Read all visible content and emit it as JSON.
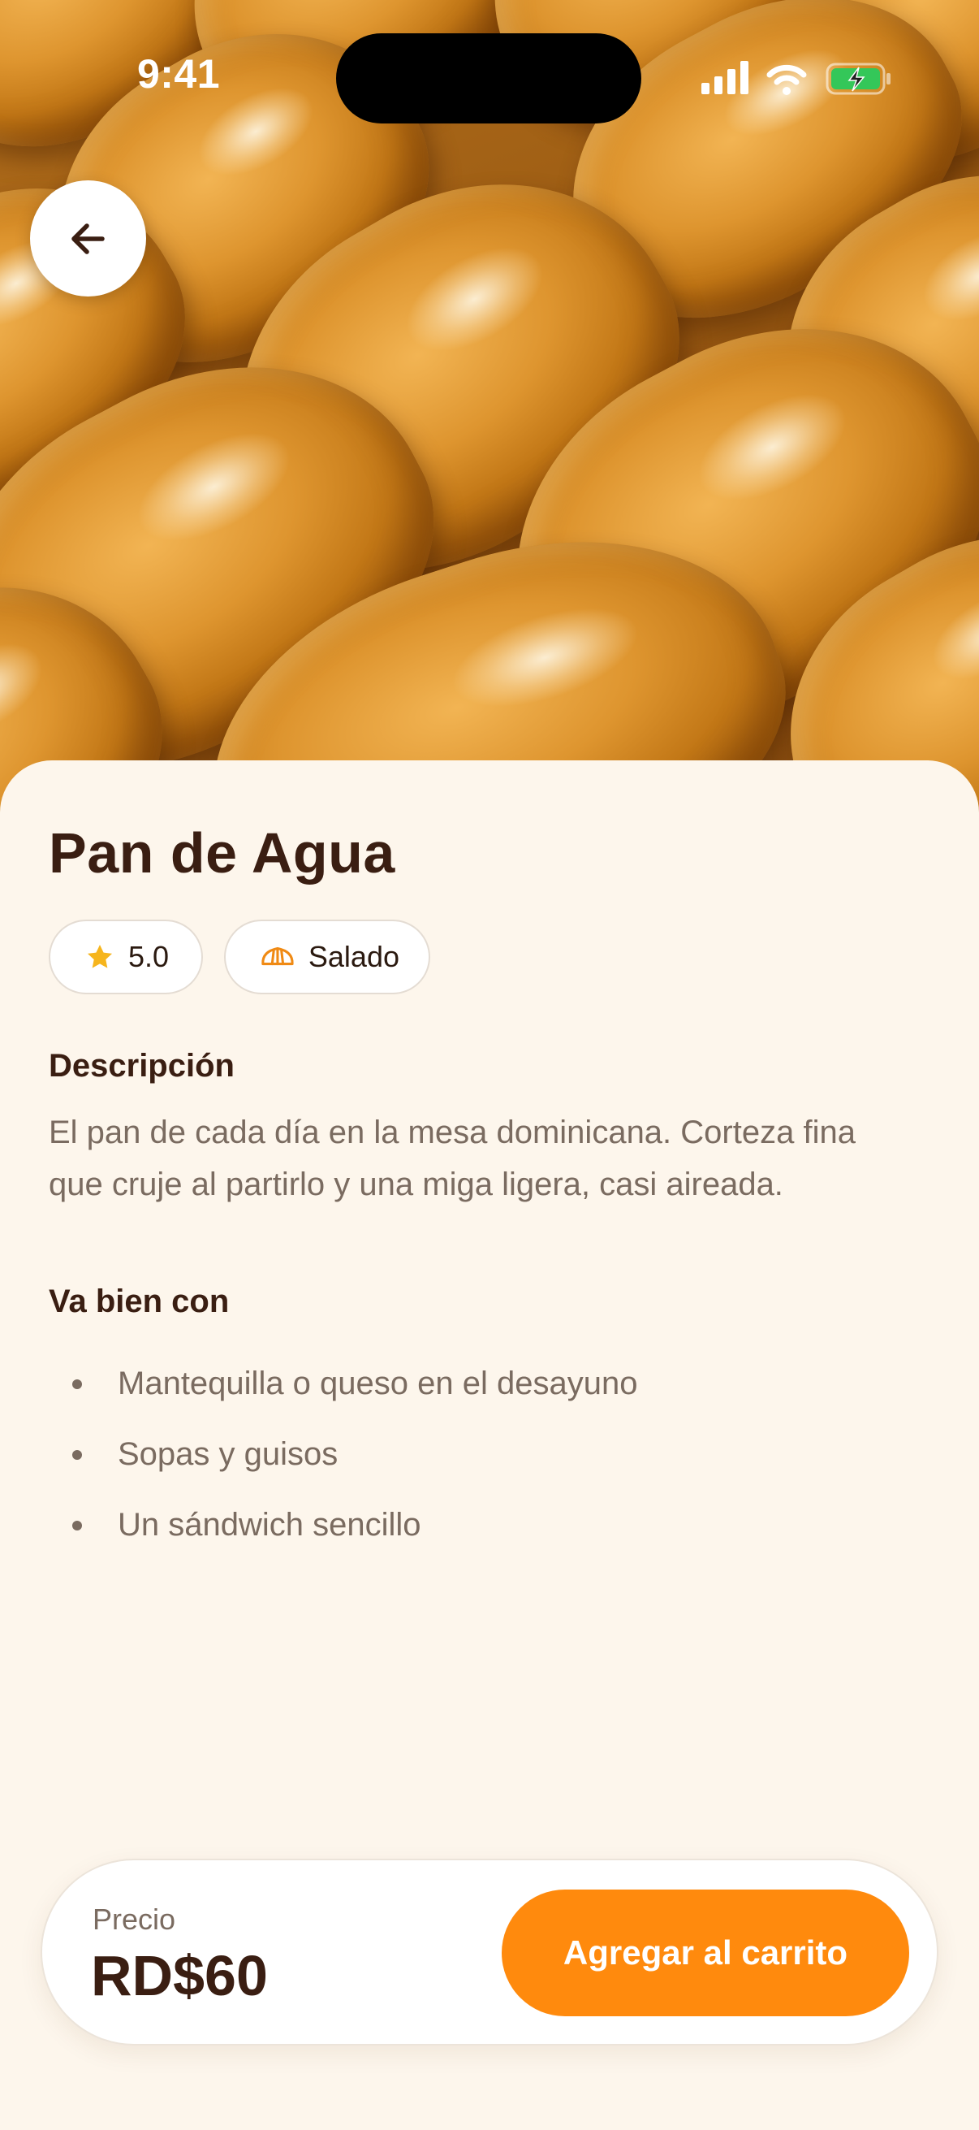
{
  "status_bar": {
    "time": "9:41",
    "battery": "charging"
  },
  "navigation": {
    "back_icon": "arrow-left-icon"
  },
  "product": {
    "title": "Pan de Agua",
    "rating": "5.0",
    "category": "Salado",
    "description_heading": "Descripción",
    "description": "El pan de cada día en la mesa dominicana. Corteza fina que cruje al partirlo y una miga ligera, casi aireada.",
    "pairings_heading": "Va bien con",
    "pairings": [
      "Mantequilla o queso en el desayuno",
      "Sopas y guisos",
      "Un sándwich sencillo"
    ]
  },
  "purchase": {
    "price_label": "Precio",
    "price": "RD$60",
    "add_to_cart_label": "Agregar al carrito"
  },
  "colors": {
    "accent": "#FF8A0D",
    "background": "#FDF6EC",
    "text_primary": "#3A1E12",
    "text_secondary": "#7A6B60",
    "star": "#F6B51D"
  }
}
